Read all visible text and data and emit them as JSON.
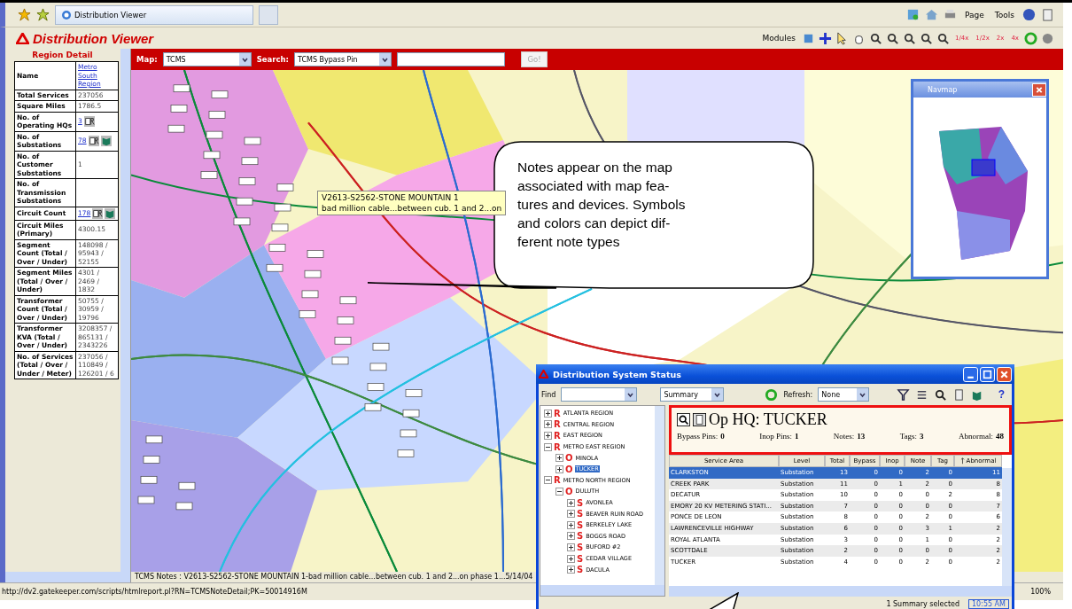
{
  "browser": {
    "tab_title": "Distribution Viewer",
    "toolbar": [
      "Page",
      "Tools"
    ],
    "status_url": "http://dv2.gatekeeper.com/scripts/htmlreport.pl?RN=TCMSNoteDetail;PK=50014916M",
    "zoom": "100%"
  },
  "app": {
    "title": "Distribution Viewer",
    "modules_label": "Modules",
    "zoom_buttons": [
      "1/4x",
      "1/2x",
      "2x",
      "4x"
    ]
  },
  "region_detail": {
    "title": "Region Detail",
    "rows": [
      {
        "label": "Name",
        "value": "Metro South Region",
        "kind": "link"
      },
      {
        "label": "Total Services",
        "value": "237056",
        "kind": "text"
      },
      {
        "label": "Square Miles",
        "value": "1786.5",
        "kind": "text"
      },
      {
        "label": "No. of Operating HQs",
        "value": "3",
        "kind": "link_report"
      },
      {
        "label": "No. of Substations",
        "value": "78",
        "kind": "link_report_map"
      },
      {
        "label": "No. of Customer Substations",
        "value": "1",
        "kind": "text"
      },
      {
        "label": "No. of Transmission Substations",
        "kind": "text"
      },
      {
        "label": "Circuit Count",
        "value": "178",
        "kind": "link_report_map"
      },
      {
        "label": "Circuit Miles (Primary)",
        "value": "4300.15",
        "kind": "text"
      },
      {
        "label": "Segment Count (Total / Over / Under)",
        "value": "148098 / 95943 / 52155",
        "kind": "text"
      },
      {
        "label": "Segment Miles (Total / Over / Under)",
        "value": "4301 / 2469 / 1832",
        "kind": "text"
      },
      {
        "label": "Transformer Count (Total / Over / Under)",
        "value": "50755 / 30959 / 19796",
        "kind": "text"
      },
      {
        "label": "Transformer KVA (Total / Over / Under)",
        "value": "3208357 / 865131 / 2343226",
        "kind": "text"
      },
      {
        "label": "No. of Services (Total / Over / Under / Meter)",
        "value": "237056 / 110849 / 126201 / 6",
        "kind": "text"
      }
    ]
  },
  "map_controls": {
    "map_label": "Map:",
    "map_value": "TCMS",
    "search_label": "Search:",
    "search_value": "TCMS Bypass Pin",
    "go_label": "Go!",
    "go_disabled": true
  },
  "map": {
    "tooltip_lines": [
      "V2613-S2562-STONE MOUNTAIN 1",
      "bad million cable...between cub. 1 and 2...on"
    ],
    "callout": "Notes appear on the map\nassociated with map fea-\ntures and devices. Symbols\nand colors can depict dif-\nferent note types",
    "navmap_title": "Navmap",
    "notes_status": "TCMS Notes : V2613-S2562-STONE MOUNTAIN 1-bad million cable...between cub. 1 and 2...on phase 1...5/14/04"
  },
  "status_window": {
    "title": "Distribution System Status",
    "find_label": "Find",
    "view_value": "Summary",
    "refresh_label": "Refresh:",
    "refresh_value": "None",
    "help_label": "?",
    "tree": [
      {
        "badge": "R",
        "label": "ATLANTA REGION",
        "expanded": false,
        "selected": false
      },
      {
        "badge": "R",
        "label": "CENTRAL REGION",
        "expanded": false,
        "selected": false
      },
      {
        "badge": "R",
        "label": "EAST REGION",
        "expanded": false,
        "selected": false
      },
      {
        "badge": "R",
        "label": "METRO EAST REGION",
        "expanded": true,
        "selected": false,
        "children": [
          {
            "badge": "O",
            "label": "MINOLA",
            "expanded": false,
            "selected": false
          },
          {
            "badge": "O",
            "label": "TUCKER",
            "expanded": false,
            "selected": true
          }
        ]
      },
      {
        "badge": "R",
        "label": "METRO NORTH REGION",
        "expanded": true,
        "selected": false,
        "children": [
          {
            "badge": "O",
            "label": "DULUTH",
            "expanded": true,
            "selected": false,
            "children": [
              {
                "badge": "S",
                "label": "AVONLEA",
                "expanded": false,
                "selected": false
              },
              {
                "badge": "S",
                "label": "BEAVER RUIN ROAD",
                "expanded": false,
                "selected": false
              },
              {
                "badge": "S",
                "label": "BERKELEY LAKE",
                "expanded": false,
                "selected": false
              },
              {
                "badge": "S",
                "label": "BOGGS ROAD",
                "expanded": false,
                "selected": false
              },
              {
                "badge": "S",
                "label": "BUFORD #2",
                "expanded": false,
                "selected": false
              },
              {
                "badge": "S",
                "label": "CEDAR VILLAGE",
                "expanded": false,
                "selected": false
              },
              {
                "badge": "S",
                "label": "DACULA",
                "expanded": false,
                "selected": false
              }
            ]
          }
        ]
      }
    ],
    "header": {
      "title": "Op HQ: TUCKER",
      "stats": [
        {
          "label": "Bypass Pins:",
          "value": "0"
        },
        {
          "label": "Inop Pins:",
          "value": "1"
        },
        {
          "label": "Notes:",
          "value": "13"
        },
        {
          "label": "Tags:",
          "value": "3"
        },
        {
          "label": "Abnormal:",
          "value": "48"
        }
      ]
    },
    "columns": [
      "Service Area",
      "Level",
      "Total",
      "Bypass",
      "Inop",
      "Note",
      "Tag",
      "Abnormal"
    ],
    "rows": [
      {
        "cells": [
          "CLARKSTON",
          "Substation",
          "13",
          "0",
          "0",
          "2",
          "0",
          "11"
        ],
        "selected": true
      },
      {
        "cells": [
          "CREEK PARK",
          "Substation",
          "11",
          "0",
          "1",
          "2",
          "0",
          "8"
        ],
        "selected": false
      },
      {
        "cells": [
          "DECATUR",
          "Substation",
          "10",
          "0",
          "0",
          "0",
          "2",
          "8"
        ],
        "selected": false
      },
      {
        "cells": [
          "EMORY 20 KV METERING STATI...",
          "Substation",
          "7",
          "0",
          "0",
          "0",
          "0",
          "7"
        ],
        "selected": false
      },
      {
        "cells": [
          "PONCE DE LEON",
          "Substation",
          "8",
          "0",
          "0",
          "2",
          "0",
          "6"
        ],
        "selected": false
      },
      {
        "cells": [
          "LAWRENCEVILLE HIGHWAY",
          "Substation",
          "6",
          "0",
          "0",
          "3",
          "1",
          "2"
        ],
        "selected": false
      },
      {
        "cells": [
          "ROYAL ATLANTA",
          "Substation",
          "3",
          "0",
          "0",
          "1",
          "0",
          "2"
        ],
        "selected": false
      },
      {
        "cells": [
          "SCOTTDALE",
          "Substation",
          "2",
          "0",
          "0",
          "0",
          "0",
          "2"
        ],
        "selected": false
      },
      {
        "cells": [
          "TUCKER",
          "Substation",
          "4",
          "0",
          "0",
          "2",
          "0",
          "2"
        ],
        "selected": false
      }
    ],
    "status_text": "1 Summary selected",
    "time": "10:55 AM"
  }
}
